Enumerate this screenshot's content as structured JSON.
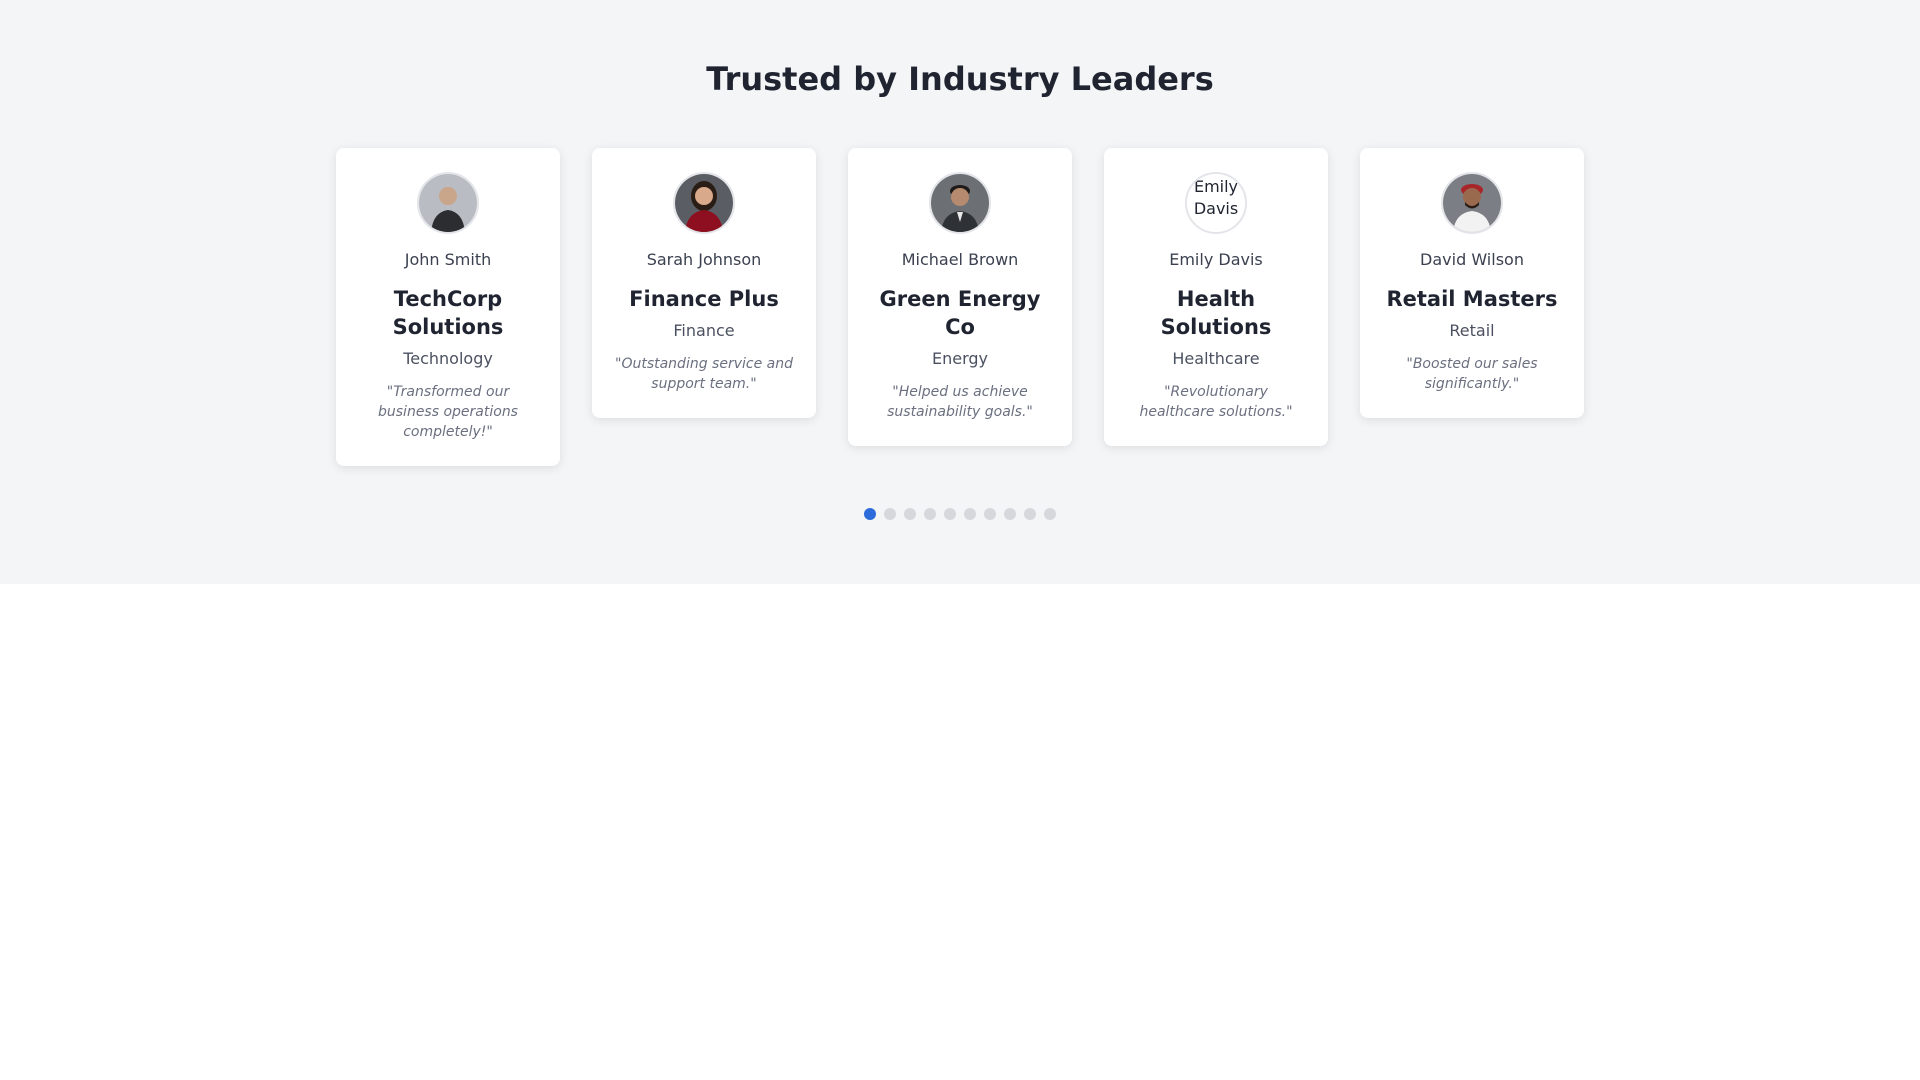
{
  "section": {
    "heading": "Trusted by Industry Leaders"
  },
  "testimonials": [
    {
      "person": "John Smith",
      "company": "TechCorp Solutions",
      "industry": "Technology",
      "quote": "\"Transformed our business operations completely!\"",
      "avatar_alt": "John Smith",
      "avatar_loaded": true
    },
    {
      "person": "Sarah Johnson",
      "company": "Finance Plus",
      "industry": "Finance",
      "quote": "\"Outstanding service and support team.\"",
      "avatar_alt": "Sarah Johnson",
      "avatar_loaded": true
    },
    {
      "person": "Michael Brown",
      "company": "Green Energy Co",
      "industry": "Energy",
      "quote": "\"Helped us achieve sustainability goals.\"",
      "avatar_alt": "Michael Brown",
      "avatar_loaded": true
    },
    {
      "person": "Emily Davis",
      "company": "Health Solutions",
      "industry": "Healthcare",
      "quote": "\"Revolutionary healthcare solutions.\"",
      "avatar_alt": "Emily Davis",
      "avatar_loaded": false
    },
    {
      "person": "David Wilson",
      "company": "Retail Masters",
      "industry": "Retail",
      "quote": "\"Boosted our sales significantly.\"",
      "avatar_alt": "David Wilson",
      "avatar_loaded": true
    }
  ],
  "pagination": {
    "total": 10,
    "active_index": 0
  },
  "colors": {
    "section_bg": "#f4f5f7",
    "heading": "#1f2430",
    "active_dot": "#2d6bdb",
    "inactive_dot": "#d6d8dc"
  }
}
